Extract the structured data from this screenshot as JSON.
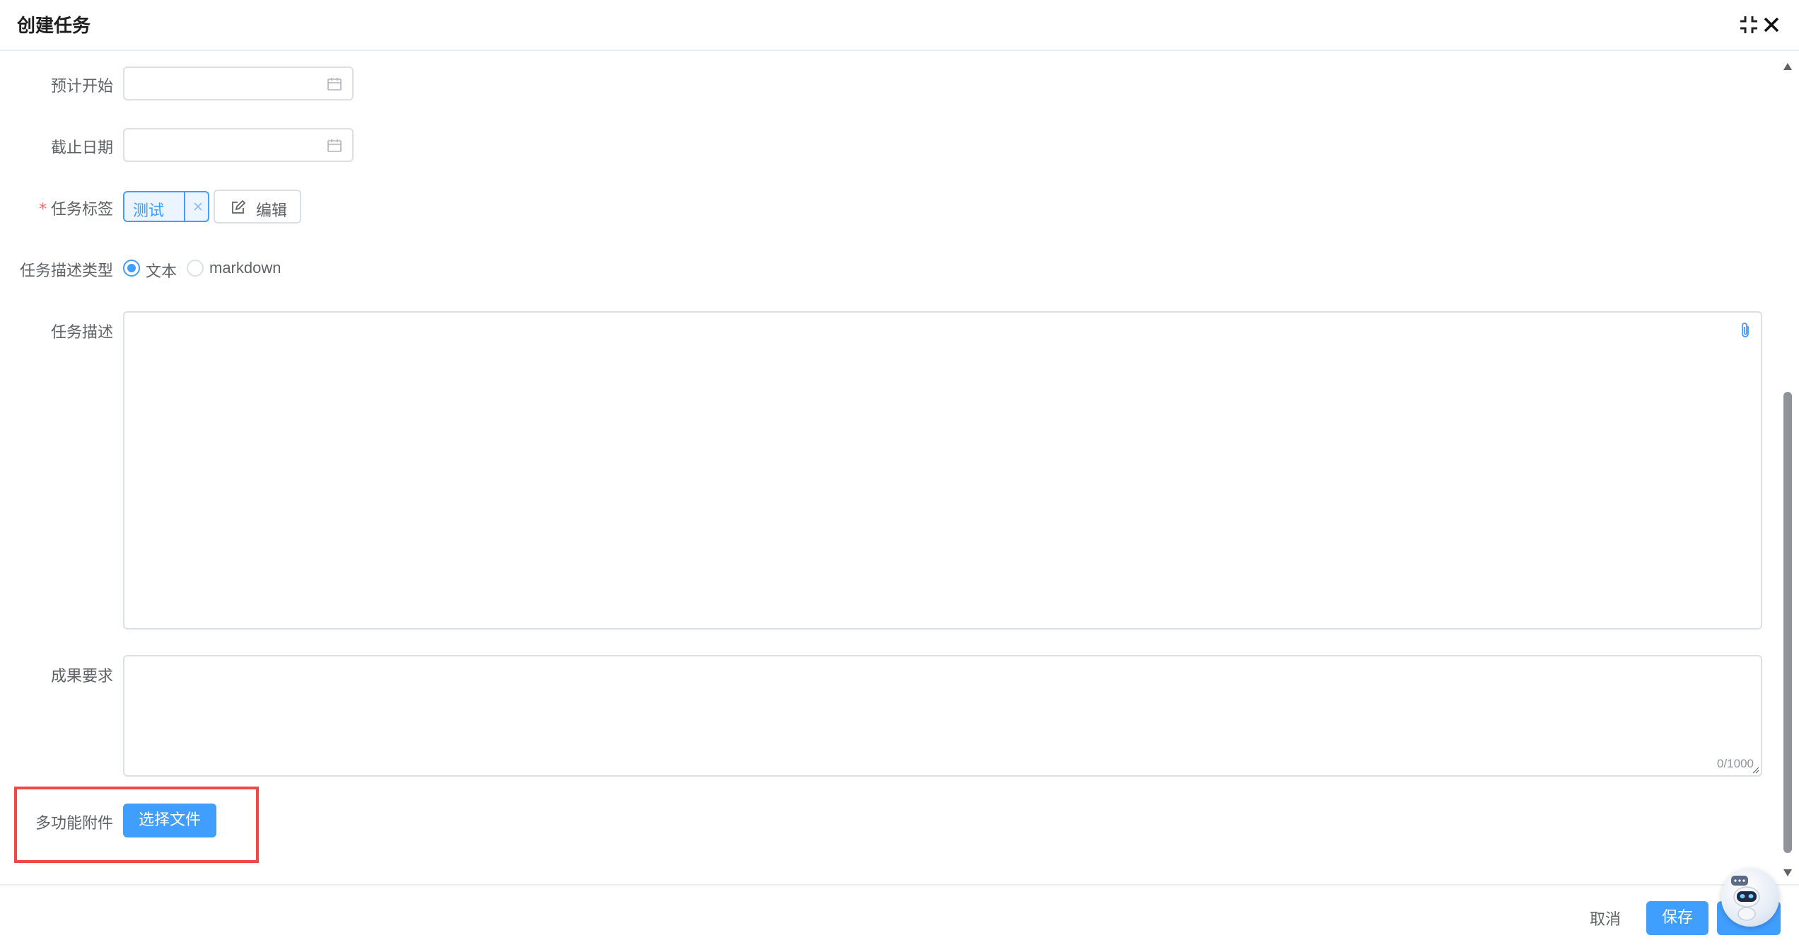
{
  "dialog": {
    "title": "创建任务"
  },
  "form": {
    "planned_start": {
      "label": "预计开始",
      "value": "",
      "placeholder": ""
    },
    "deadline": {
      "label": "截止日期",
      "value": "",
      "placeholder": ""
    },
    "task_tags": {
      "label": "任务标签",
      "required_mark": "*",
      "tags": [
        "测试"
      ],
      "edit_label": "编辑"
    },
    "desc_type": {
      "label": "任务描述类型",
      "options": [
        "文本",
        "markdown"
      ],
      "selected": "文本"
    },
    "description": {
      "label": "任务描述",
      "value": ""
    },
    "result_requirement": {
      "label": "成果要求",
      "value": "",
      "counter": "0/1000"
    },
    "attachment": {
      "label": "多功能附件",
      "button_label": "选择文件"
    }
  },
  "footer": {
    "cancel_label": "取消",
    "save_label": "保存"
  },
  "icons": {
    "minimize": "compress-icon",
    "close": "close-icon",
    "calendar": "calendar-icon",
    "edit": "edit-icon",
    "attach": "paperclip-icon",
    "assistant": "robot-assistant-icon"
  },
  "colors": {
    "primary": "#409eff",
    "required": "#f56c6c",
    "highlight": "#f04848"
  }
}
